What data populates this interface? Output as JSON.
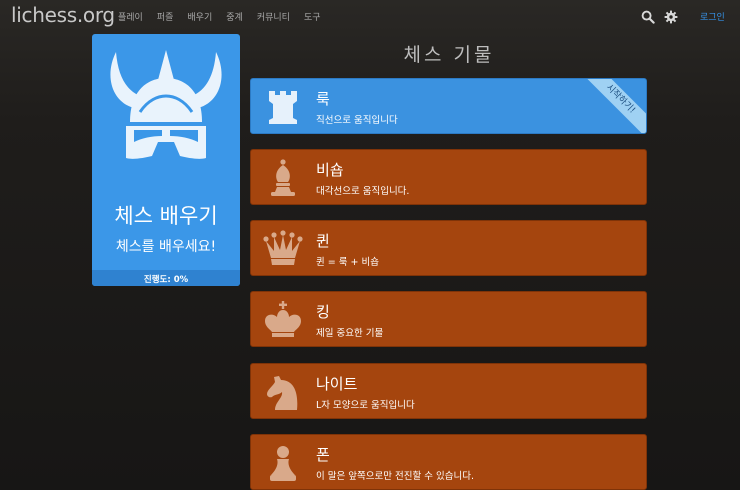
{
  "header": {
    "logo": "lichess.org",
    "nav": [
      "플레이",
      "퍼즐",
      "배우기",
      "중계",
      "커뮤니티",
      "도구"
    ],
    "login": "로그인",
    "icons": [
      "search-icon",
      "gear-icon"
    ]
  },
  "sidebar": {
    "title": "체스 배우기",
    "subtitle": "체스를 배우세요!",
    "progress_label": "진행도: 0%",
    "progress": 0
  },
  "main": {
    "title": "체스 기물",
    "stages": [
      {
        "name": "룩",
        "desc": "직선으로 움직입니다",
        "icon": "rook-icon",
        "active": true,
        "ribbon": "시작하기!"
      },
      {
        "name": "비숍",
        "desc": "대각선으로 움직입니다.",
        "icon": "bishop-icon",
        "active": false
      },
      {
        "name": "퀸",
        "desc": "퀸 = 룩 + 비숍",
        "icon": "queen-icon",
        "active": false
      },
      {
        "name": "킹",
        "desc": "제일 중요한 기물",
        "icon": "king-icon",
        "active": false
      },
      {
        "name": "나이트",
        "desc": "L자 모양으로 움직입니다",
        "icon": "knight-icon",
        "active": false
      },
      {
        "name": "폰",
        "desc": "이 말은 앞쪽으로만 전진할 수 있습니다.",
        "icon": "pawn-icon",
        "active": false
      }
    ]
  },
  "colors": {
    "accent_blue": "#3b97e8",
    "stage_orange": "#a5450e",
    "link": "#3692e7"
  }
}
